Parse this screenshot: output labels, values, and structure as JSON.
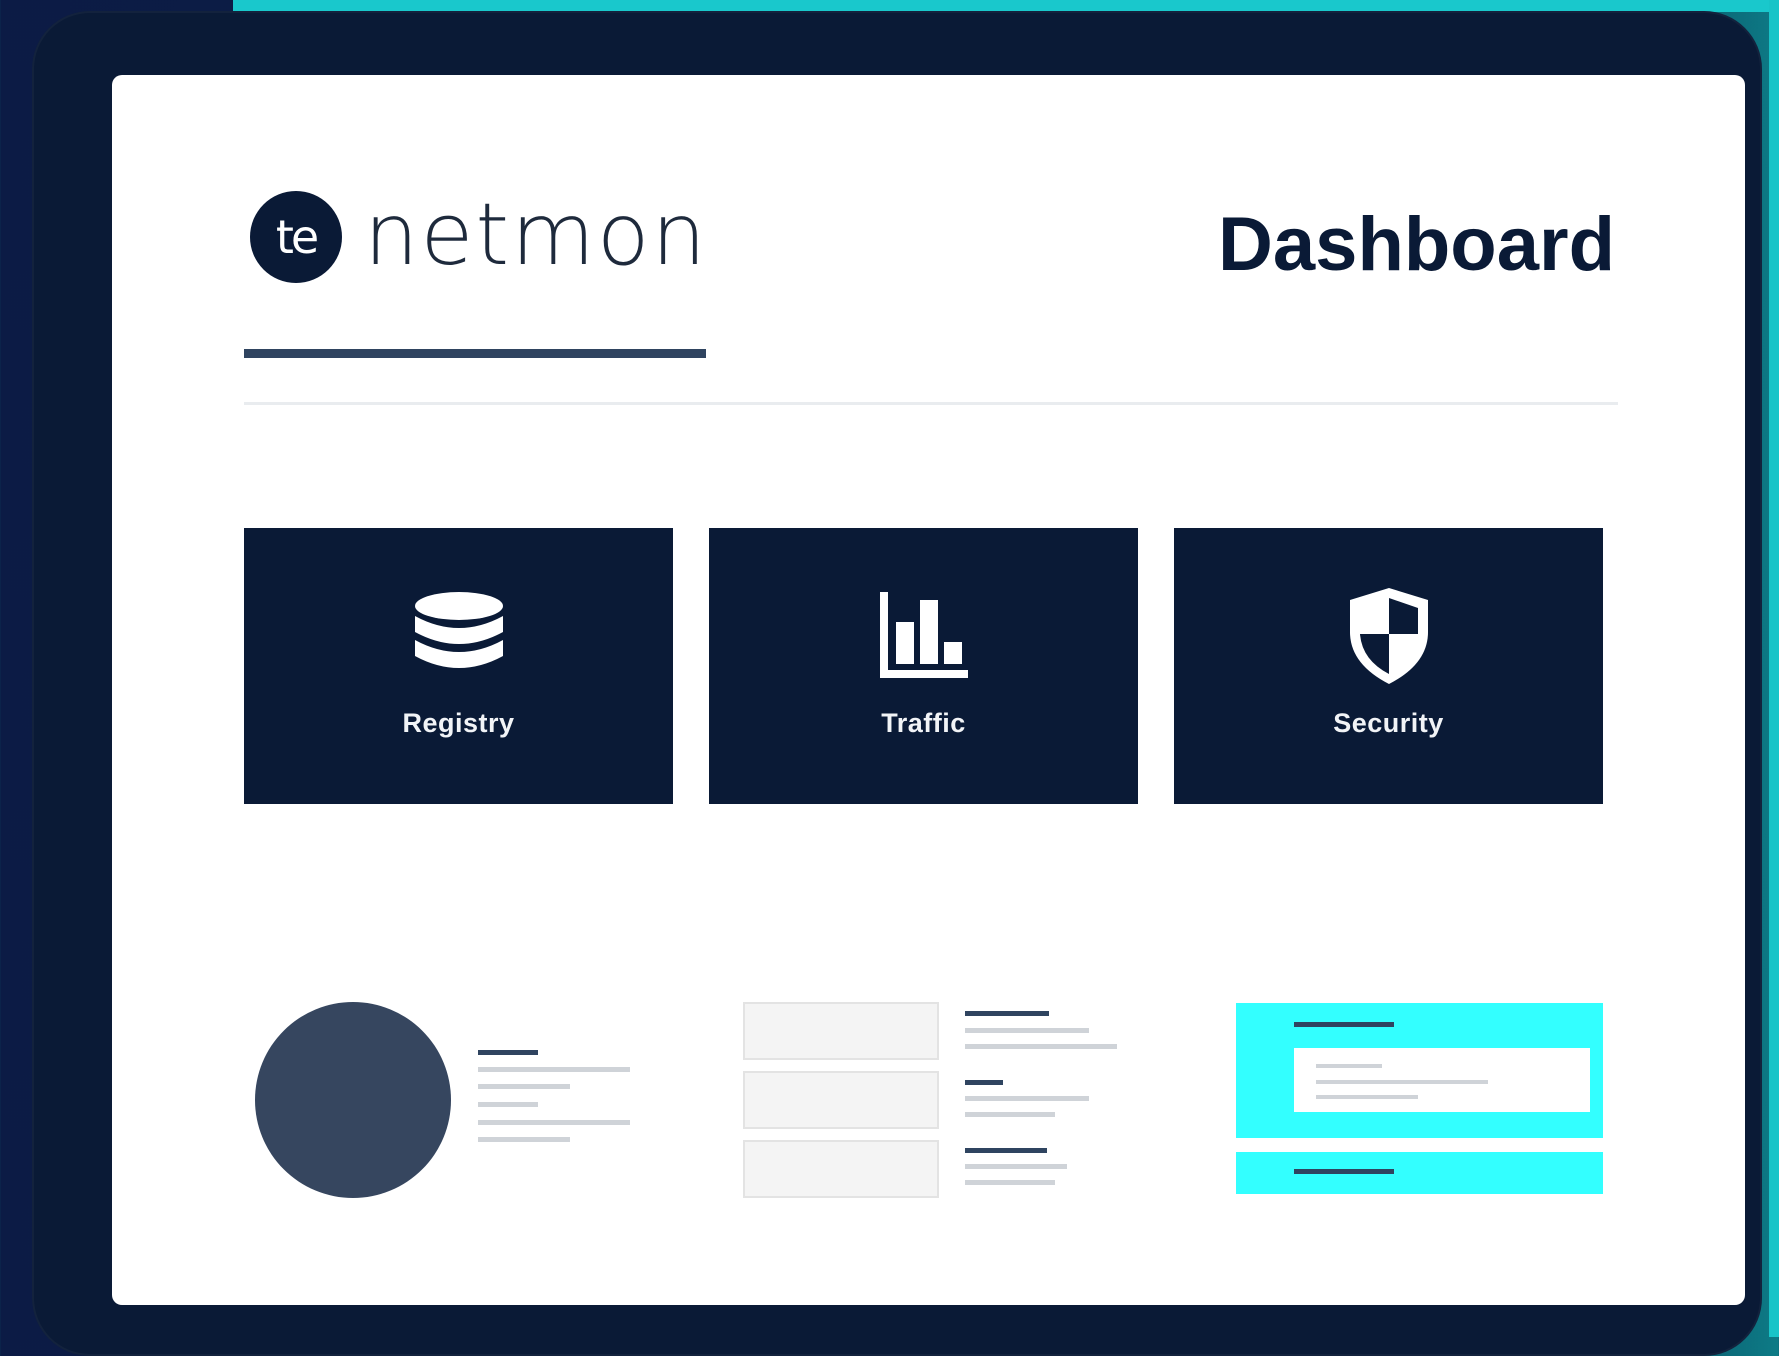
{
  "brand": {
    "logo_mark": "te",
    "name": "netmon"
  },
  "header": {
    "title": "Dashboard"
  },
  "cards": [
    {
      "label": "Registry",
      "icon": "database-icon"
    },
    {
      "label": "Traffic",
      "icon": "bar-chart-icon"
    },
    {
      "label": "Security",
      "icon": "shield-icon"
    }
  ],
  "colors": {
    "navy": "#0a1a36",
    "accent_cyan": "#33ffff",
    "slate": "#36465f",
    "rule": "#2f4460",
    "background_teal": "#19c8cc"
  }
}
